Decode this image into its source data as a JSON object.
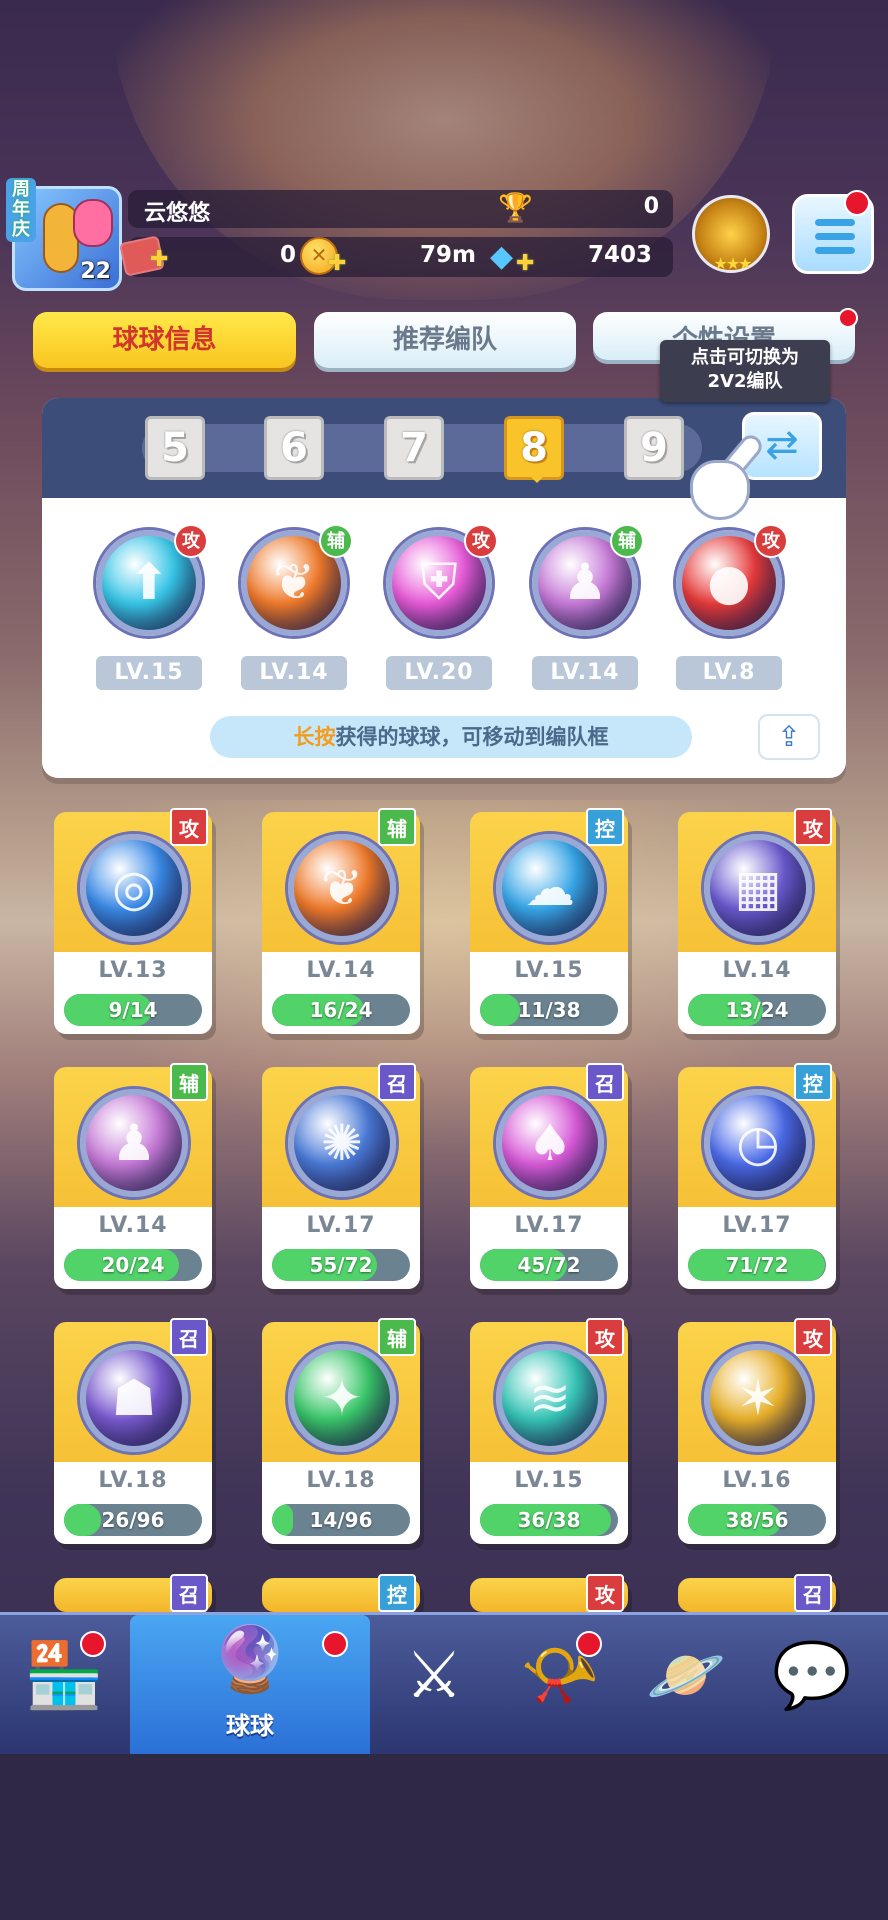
{
  "player": {
    "anniversary_label": "周年庆",
    "level": "22",
    "name": "云悠悠",
    "trophies": "0",
    "tickets": "0",
    "coins": "79m",
    "gems": "7403"
  },
  "tabs": [
    {
      "label": "球球信息"
    },
    {
      "label": "推荐编队"
    },
    {
      "label": "个性设置"
    }
  ],
  "tooltip": {
    "line1": "点击可切换为",
    "line2": "2V2编队"
  },
  "slots": [
    "5",
    "6",
    "7",
    "8",
    "9"
  ],
  "active_slot": "8",
  "team": [
    {
      "level": "LV.15",
      "role": "攻",
      "role_type": "atk",
      "icon": "arrow-orb-icon",
      "color": "#36c6e8"
    },
    {
      "level": "LV.14",
      "role": "辅",
      "role_type": "sup",
      "icon": "wings-orb-icon",
      "color": "#f07a2a"
    },
    {
      "level": "LV.20",
      "role": "攻",
      "role_type": "atk",
      "icon": "shield-orb-icon",
      "color": "#e85ad8"
    },
    {
      "level": "LV.14",
      "role": "辅",
      "role_type": "sup",
      "icon": "shadow-people-orb-icon",
      "color": "#c77ad8"
    },
    {
      "level": "LV.8",
      "role": "攻",
      "role_type": "atk",
      "icon": "red-blob-orb-icon",
      "color": "#e83a3a"
    }
  ],
  "hint": {
    "highlight": "长按",
    "text": "获得的球球，可移动到编队框"
  },
  "balls": [
    {
      "level": "LV.13",
      "progress": "9/14",
      "fill": 0.64,
      "role": "攻",
      "role_type": "atk",
      "icon": "swirl-orb-icon",
      "color": "#3a8ae8"
    },
    {
      "level": "LV.14",
      "progress": "16/24",
      "fill": 0.67,
      "role": "辅",
      "role_type": "sup",
      "icon": "wings-orb-icon",
      "color": "#f07a2a"
    },
    {
      "level": "LV.15",
      "progress": "11/38",
      "fill": 0.29,
      "role": "控",
      "role_type": "ctl",
      "icon": "cloud-orb-icon",
      "color": "#36a6e8"
    },
    {
      "level": "LV.14",
      "progress": "13/24",
      "fill": 0.54,
      "role": "攻",
      "role_type": "atk",
      "icon": "grid-orb-icon",
      "color": "#6a5ad0"
    },
    {
      "level": "LV.14",
      "progress": "20/24",
      "fill": 0.83,
      "role": "辅",
      "role_type": "sup",
      "icon": "shadow-people-orb-icon",
      "color": "#c77ad8"
    },
    {
      "level": "LV.17",
      "progress": "55/72",
      "fill": 0.76,
      "role": "召",
      "role_type": "sum",
      "icon": "vortex-orb-icon",
      "color": "#4a7ad8"
    },
    {
      "level": "LV.17",
      "progress": "45/72",
      "fill": 0.63,
      "role": "召",
      "role_type": "sum",
      "icon": "mushroom-orb-icon",
      "color": "#d85ad8"
    },
    {
      "level": "LV.17",
      "progress": "71/72",
      "fill": 0.99,
      "role": "控",
      "role_type": "ctl",
      "icon": "clock-orb-icon",
      "color": "#4a6ae8"
    },
    {
      "level": "LV.18",
      "progress": "26/96",
      "fill": 0.27,
      "role": "召",
      "role_type": "sum",
      "icon": "ghost-orb-icon",
      "color": "#7a5ad0"
    },
    {
      "level": "LV.18",
      "progress": "14/96",
      "fill": 0.15,
      "role": "辅",
      "role_type": "sup",
      "icon": "star-arrow-orb-icon",
      "color": "#3ac86a"
    },
    {
      "level": "LV.15",
      "progress": "36/38",
      "fill": 0.95,
      "role": "攻",
      "role_type": "atk",
      "icon": "tornado-orb-icon",
      "color": "#36c6b8"
    },
    {
      "level": "LV.16",
      "progress": "38/56",
      "fill": 0.68,
      "role": "攻",
      "role_type": "atk",
      "icon": "shuriken-orb-icon",
      "color": "#e8b02a"
    }
  ],
  "partial_row_roles": [
    {
      "role": "召",
      "role_type": "sum"
    },
    {
      "role": "控",
      "role_type": "ctl"
    },
    {
      "role": "攻",
      "role_type": "atk"
    },
    {
      "role": "召",
      "role_type": "sum"
    }
  ],
  "nav": [
    {
      "id": "shop",
      "icon": "shop-icon",
      "label": "",
      "badge": true
    },
    {
      "id": "balls",
      "icon": "ball-icon",
      "label": "球球",
      "badge": true,
      "active": true
    },
    {
      "id": "battle",
      "icon": "crossed-swords-icon",
      "label": "",
      "badge": false
    },
    {
      "id": "whistle",
      "icon": "whistle-icon",
      "label": "",
      "badge": true
    },
    {
      "id": "planet",
      "icon": "planet-icon",
      "label": "",
      "badge": false
    },
    {
      "id": "social",
      "icon": "chat-heart-icon",
      "label": "",
      "badge": false
    }
  ]
}
